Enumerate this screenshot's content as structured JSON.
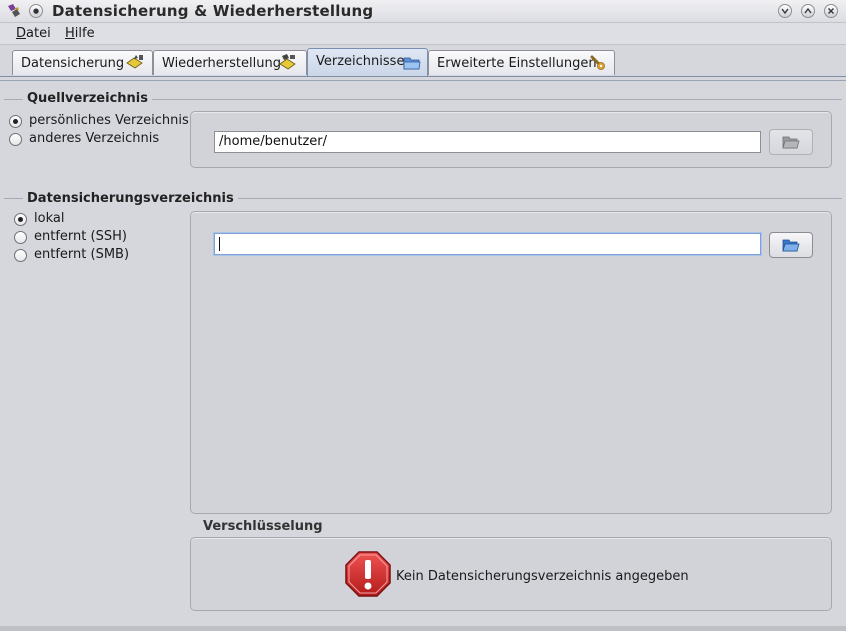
{
  "window": {
    "title": "Datensicherung & Wiederherstellung",
    "controls": [
      "minimize",
      "maximize",
      "close"
    ]
  },
  "menu": [
    {
      "label": "Datei",
      "mnemonic": "D"
    },
    {
      "label": "Hilfe",
      "mnemonic": "H"
    }
  ],
  "tabs": [
    {
      "label": "Datensicherung",
      "icon": "backup-icon",
      "active": false
    },
    {
      "label": "Wiederherstellung",
      "icon": "restore-icon",
      "active": false
    },
    {
      "label": "Verzeichnisse",
      "icon": "folder-icon",
      "active": true
    },
    {
      "label": "Erweiterte Einstellungen",
      "icon": "wrench-icon",
      "active": false
    }
  ],
  "source": {
    "title": "Quellverzeichnis",
    "options": [
      {
        "label": "persönliches Verzeichnis",
        "selected": true
      },
      {
        "label": "anderes Verzeichnis",
        "selected": false
      }
    ],
    "path_value": "/home/benutzer/",
    "browse_button": {
      "icon": "folder-open-icon",
      "enabled": false
    }
  },
  "destination": {
    "title": "Datensicherungsverzeichnis",
    "options": [
      {
        "label": "lokal",
        "selected": true
      },
      {
        "label": "entfernt (SSH)",
        "selected": false
      },
      {
        "label": "entfernt (SMB)",
        "selected": false
      }
    ],
    "path_value": "",
    "browse_button": {
      "icon": "folder-open-icon",
      "enabled": true
    }
  },
  "encryption": {
    "title": "Verschlüsselung",
    "status_icon": "stop-warning-icon",
    "status_text": "Kein Datensicherungsverzeichnis angegeben"
  },
  "colors": {
    "background": "#d6d7dd",
    "active_tab": "#cbd6e8",
    "stop_sign": "#d42a2a",
    "folder_blue": "#3b76c9"
  }
}
